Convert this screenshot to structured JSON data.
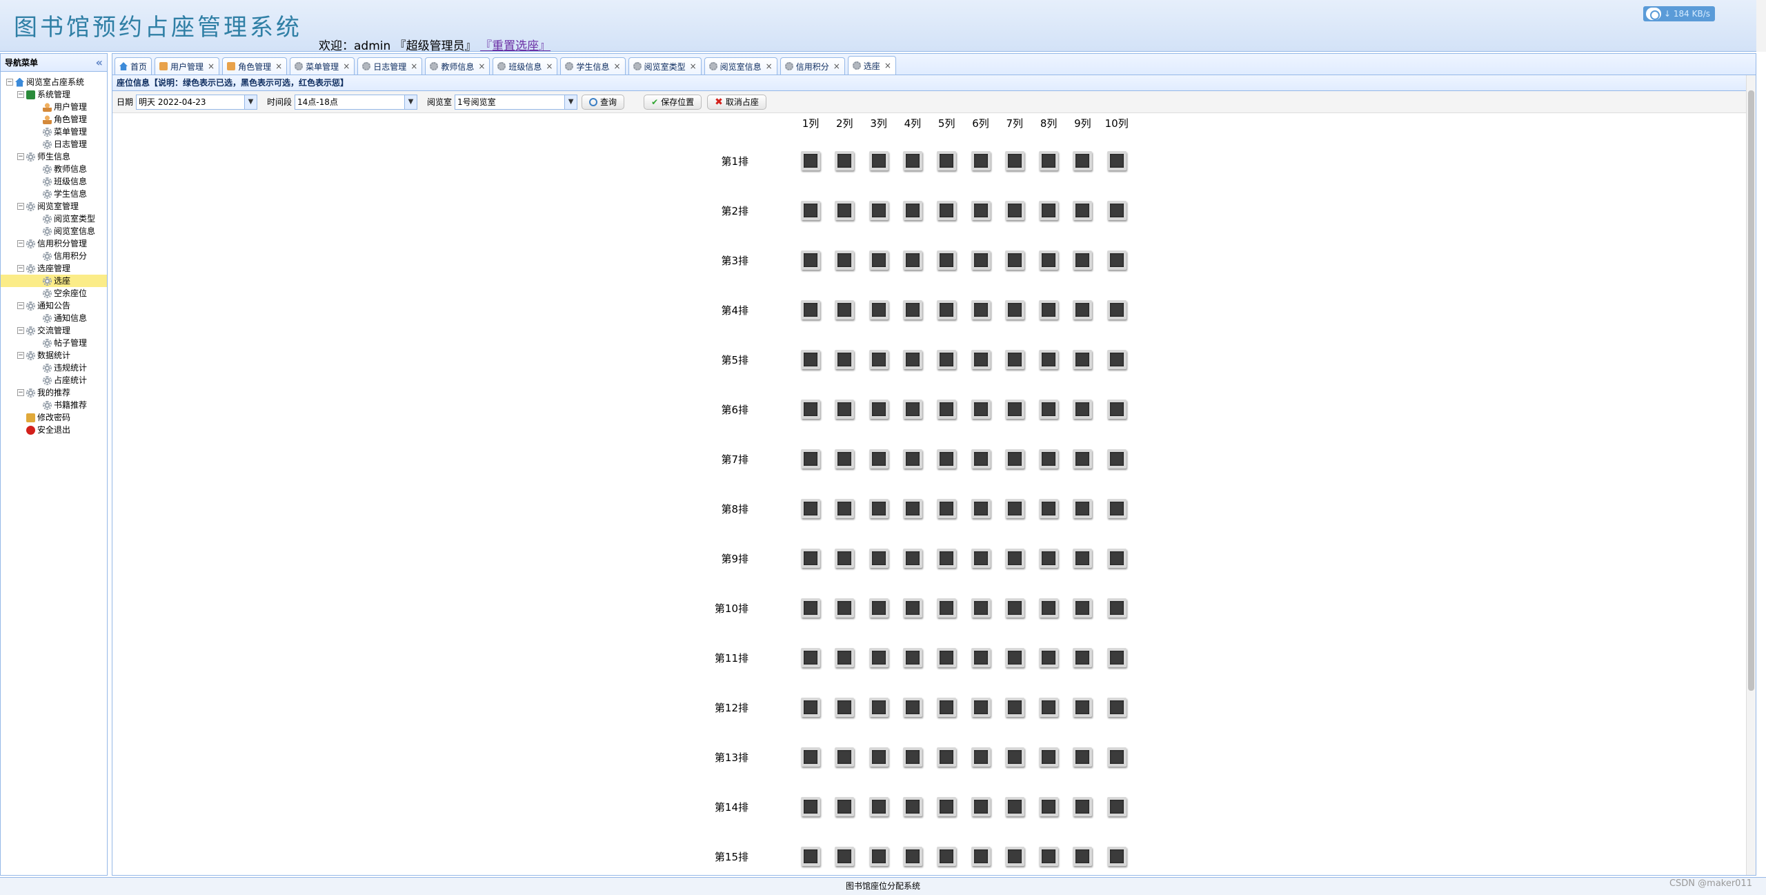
{
  "header": {
    "title": "图书馆预约占座管理系统",
    "welcome": "欢迎：admin 『超级管理员』",
    "reset_link": "『重置选座』",
    "net_speed": "↓ 184 KB/s"
  },
  "sidebar": {
    "title": "导航菜单",
    "tree": [
      {
        "label": "阅览室占座系统",
        "level": 0,
        "toggle": "⊟",
        "icon": "home"
      },
      {
        "label": "系统管理",
        "level": 1,
        "toggle": "⊟",
        "icon": "green"
      },
      {
        "label": "用户管理",
        "level": 2,
        "icon": "user"
      },
      {
        "label": "角色管理",
        "level": 2,
        "icon": "user"
      },
      {
        "label": "菜单管理",
        "level": 2,
        "icon": "gear"
      },
      {
        "label": "日志管理",
        "level": 2,
        "icon": "gear"
      },
      {
        "label": "师生信息",
        "level": 1,
        "toggle": "⊟",
        "icon": "gear"
      },
      {
        "label": "教师信息",
        "level": 2,
        "icon": "gear"
      },
      {
        "label": "班级信息",
        "level": 2,
        "icon": "gear"
      },
      {
        "label": "学生信息",
        "level": 2,
        "icon": "gear"
      },
      {
        "label": "阅览室管理",
        "level": 1,
        "toggle": "⊟",
        "icon": "gear"
      },
      {
        "label": "阅览室类型",
        "level": 2,
        "icon": "gear"
      },
      {
        "label": "阅览室信息",
        "level": 2,
        "icon": "gear"
      },
      {
        "label": "信用积分管理",
        "level": 1,
        "toggle": "⊟",
        "icon": "gear"
      },
      {
        "label": "信用积分",
        "level": 2,
        "icon": "gear"
      },
      {
        "label": "选座管理",
        "level": 1,
        "toggle": "⊟",
        "icon": "gear"
      },
      {
        "label": "选座",
        "level": 2,
        "icon": "gear",
        "selected": true
      },
      {
        "label": "空余座位",
        "level": 2,
        "icon": "gear"
      },
      {
        "label": "通知公告",
        "level": 1,
        "toggle": "⊟",
        "icon": "gear"
      },
      {
        "label": "通知信息",
        "level": 2,
        "icon": "gear"
      },
      {
        "label": "交流管理",
        "level": 1,
        "toggle": "⊟",
        "icon": "gear"
      },
      {
        "label": "帖子管理",
        "level": 2,
        "icon": "gear"
      },
      {
        "label": "数据统计",
        "level": 1,
        "toggle": "⊟",
        "icon": "gear"
      },
      {
        "label": "违规统计",
        "level": 2,
        "icon": "gear"
      },
      {
        "label": "占座统计",
        "level": 2,
        "icon": "gear"
      },
      {
        "label": "我的推荐",
        "level": 1,
        "toggle": "⊟",
        "icon": "gear"
      },
      {
        "label": "书籍推荐",
        "level": 2,
        "icon": "gear"
      },
      {
        "label": "修改密码",
        "level": 1,
        "icon": "lock"
      },
      {
        "label": "安全退出",
        "level": 1,
        "icon": "exit"
      }
    ]
  },
  "tabs": [
    {
      "label": "首页",
      "icon": "home",
      "closable": false
    },
    {
      "label": "用户管理",
      "icon": "user",
      "closable": true
    },
    {
      "label": "角色管理",
      "icon": "user",
      "closable": true
    },
    {
      "label": "菜单管理",
      "icon": "gear",
      "closable": true
    },
    {
      "label": "日志管理",
      "icon": "gear",
      "closable": true
    },
    {
      "label": "教师信息",
      "icon": "gear",
      "closable": true
    },
    {
      "label": "班级信息",
      "icon": "gear",
      "closable": true
    },
    {
      "label": "学生信息",
      "icon": "gear",
      "closable": true
    },
    {
      "label": "阅览室类型",
      "icon": "gear",
      "closable": true
    },
    {
      "label": "阅览室信息",
      "icon": "gear",
      "closable": true
    },
    {
      "label": "信用积分",
      "icon": "gear",
      "closable": true
    },
    {
      "label": "选座",
      "icon": "gear",
      "closable": true,
      "active": true
    }
  ],
  "panel": {
    "title": "座位信息【说明：绿色表示已选，黑色表示可选，红色表示惩】"
  },
  "toolbar": {
    "date_label": "日期",
    "date_value": "明天  2022-04-23",
    "period_label": "时间段",
    "period_value": "14点-18点",
    "room_label": "阅览室",
    "room_value": "1号阅览室",
    "search_label": "查询",
    "save_label": "保存位置",
    "cancel_label": "取消占座"
  },
  "seats": {
    "columns": [
      "1列",
      "2列",
      "3列",
      "4列",
      "5列",
      "6列",
      "7列",
      "8列",
      "9列",
      "10列"
    ],
    "rows": [
      "第1排",
      "第2排",
      "第3排",
      "第4排",
      "第5排",
      "第6排",
      "第7排",
      "第8排",
      "第9排",
      "第10排",
      "第11排",
      "第12排",
      "第13排",
      "第14排",
      "第15排"
    ],
    "state": "available",
    "available_color": "#3b3b3b"
  },
  "footer": {
    "text": "图书馆座位分配系统",
    "watermark": "CSDN @maker011"
  }
}
